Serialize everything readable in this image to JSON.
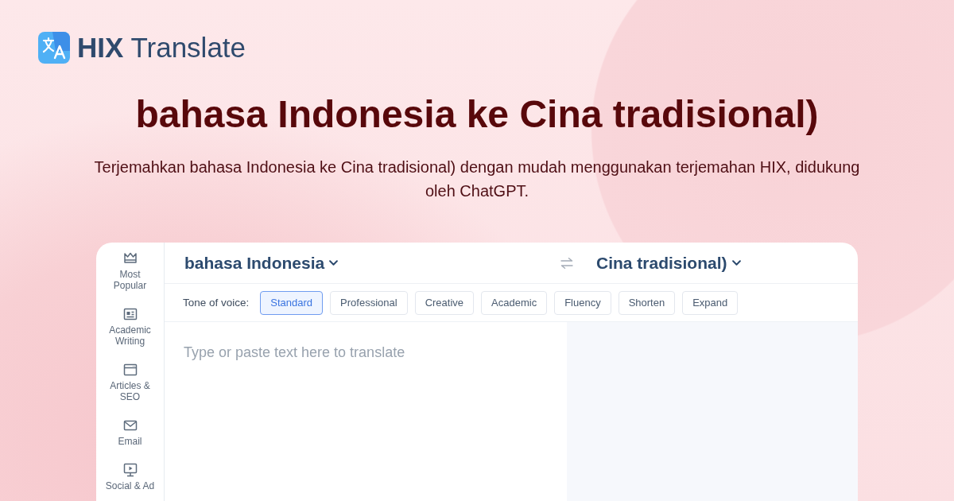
{
  "logo": {
    "text": "**HIX** Translate"
  },
  "headline": "bahasa Indonesia ke Cina tradisional)",
  "subheadline": "Terjemahkan bahasa Indonesia ke Cina tradisional) dengan mudah menggunakan terjemahan HIX, didukung oleh ChatGPT.",
  "translator": {
    "sidebar": {
      "items": [
        {
          "label": "Most Popular"
        },
        {
          "label": "Academic Writing"
        },
        {
          "label": "Articles & SEO"
        },
        {
          "label": "Email"
        },
        {
          "label": "Social & Ad"
        }
      ]
    },
    "source_language": "bahasa Indonesia",
    "target_language": "Cina tradisional)",
    "tone": {
      "label": "Tone of voice:",
      "options": [
        {
          "label": "Standard",
          "selected": true
        },
        {
          "label": "Professional",
          "selected": false
        },
        {
          "label": "Creative",
          "selected": false
        },
        {
          "label": "Academic",
          "selected": false
        },
        {
          "label": "Fluency",
          "selected": false
        },
        {
          "label": "Shorten",
          "selected": false
        },
        {
          "label": "Expand",
          "selected": false
        }
      ]
    },
    "input": {
      "placeholder": "Type or paste text here to translate"
    }
  }
}
